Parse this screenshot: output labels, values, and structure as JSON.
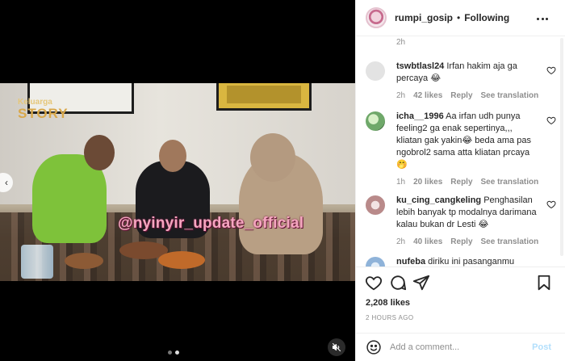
{
  "media": {
    "watermark": "@nyinyir_update_official",
    "logo_small": "Keluarga",
    "logo_big": "STORY",
    "carousel_dots": 2,
    "active_dot": 1,
    "icons": {
      "prev": "chevron-left-icon",
      "mute": "muted-speaker-icon"
    }
  },
  "header": {
    "username": "rumpi_gosip",
    "separator": "•",
    "status": "Following",
    "more_icon": "ellipsis-icon"
  },
  "top_time": "2h",
  "comments": [
    {
      "user": "tswbtlasl24",
      "text": "Irfan hakim aja ga percaya 😂",
      "time": "2h",
      "likes": "42 likes",
      "reply": "Reply",
      "translation": "See translation",
      "avatar_color": "#e3e3e3"
    },
    {
      "user": "icha__1996",
      "text": "Aa irfan udh punya feeling2 ga enak sepertinya,,, kliatan gak yakin😂 beda ama pas ngobrol2 sama atta kliatan prcaya 🤭",
      "time": "1h",
      "likes": "20 likes",
      "reply": "Reply",
      "translation": "See translation",
      "avatar_color": "#6fa86a"
    },
    {
      "user": "ku_cing_cangkeling",
      "text": "Penghasilan lebih banyak tp modalnya darimana kalau bukan dr Lesti 😂",
      "time": "2h",
      "likes": "40 likes",
      "reply": "Reply",
      "translation": "See translation",
      "avatar_color": "#b98a8a"
    },
    {
      "user": "nufeba",
      "text": "diriku ini pasanganmu",
      "avatar_color": "#8fb3d9"
    }
  ],
  "actions": {
    "like_icon": "heart-icon",
    "comment_icon": "comment-bubble-icon",
    "share_icon": "send-icon",
    "save_icon": "bookmark-icon"
  },
  "likes_count": "2,208 likes",
  "time_ago": "2 HOURS AGO",
  "add_comment": {
    "emoji_icon": "smiley-icon",
    "placeholder": "Add a comment...",
    "post_label": "Post"
  },
  "colors": {
    "accent_post": "#b2dffc",
    "muted_text": "#8e8e8e",
    "text": "#262626",
    "border": "#efefef"
  }
}
